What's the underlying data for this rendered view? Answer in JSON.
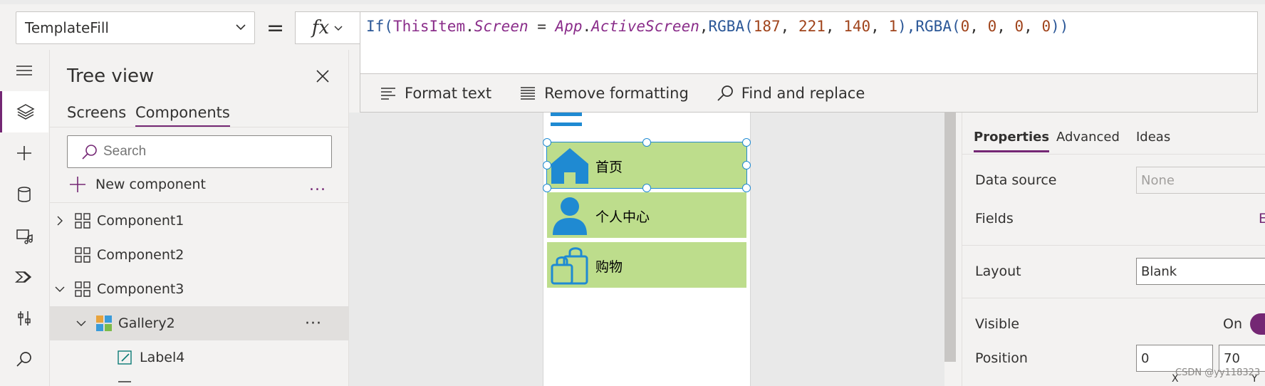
{
  "formula_bar": {
    "property_name": "TemplateFill",
    "equals": "=",
    "fx_label": "fx",
    "formula": {
      "t1": "If(",
      "t2": "ThisItem",
      "t3": ".",
      "t4": "Screen",
      "t5": " = ",
      "t6": "App",
      "t7": ".",
      "t8": "ActiveScreen",
      "t9": ",",
      "t10": "RGBA(",
      "t11": "187",
      "t12": ", ",
      "t13": "221",
      "t14": ", ",
      "t15": "140",
      "t16": ", ",
      "t17": "1",
      "t18": "),",
      "t19": "RGBA(",
      "t20": "0",
      "t21": ", ",
      "t22": "0",
      "t23": ", ",
      "t24": "0",
      "t25": ", ",
      "t26": "0",
      "t27": "))"
    },
    "format_text": "Format text",
    "remove_formatting": "Remove formatting",
    "find_replace": "Find and replace"
  },
  "rail": {
    "items": [
      "menu-icon",
      "layers-icon",
      "plus-icon",
      "data-icon",
      "media-icon",
      "power-automate-icon",
      "tools-icon",
      "search-icon"
    ]
  },
  "tree_view": {
    "title": "Tree view",
    "tabs": [
      "Screens",
      "Components"
    ],
    "active_tab": "Components",
    "search_placeholder": "Search",
    "new_component": "New component",
    "more": "...",
    "items": [
      {
        "label": "Component1",
        "expanded": false
      },
      {
        "label": "Component2",
        "expanded": null
      },
      {
        "label": "Component3",
        "expanded": true
      },
      {
        "label": "Gallery2",
        "expanded": true,
        "selected": true
      },
      {
        "label": "Label4"
      }
    ],
    "row_more": "···"
  },
  "canvas": {
    "gallery_items": [
      {
        "text": "首页",
        "icon": "home-icon",
        "selected": true
      },
      {
        "text": "个人中心",
        "icon": "person-icon",
        "selected": false
      },
      {
        "text": "购物",
        "icon": "shopping-bags-icon",
        "selected": false
      }
    ],
    "item_fill": "#bddd8c",
    "accent": "#1f8ad2"
  },
  "properties": {
    "tabs": [
      "Properties",
      "Advanced",
      "Ideas"
    ],
    "active_tab": "Properties",
    "data_source_label": "Data source",
    "data_source_value": "None",
    "fields_label": "Fields",
    "fields_value": "E",
    "layout_label": "Layout",
    "layout_value": "Blank",
    "visible_label": "Visible",
    "visible_value": "On",
    "position_label": "Position",
    "position_x": "0",
    "position_y": "70",
    "axis_x": "X",
    "axis_y": "Y"
  },
  "watermark": "CSDN @yy118323",
  "colors": {
    "brand": "#742774",
    "chrome": "#f3f2f1"
  }
}
